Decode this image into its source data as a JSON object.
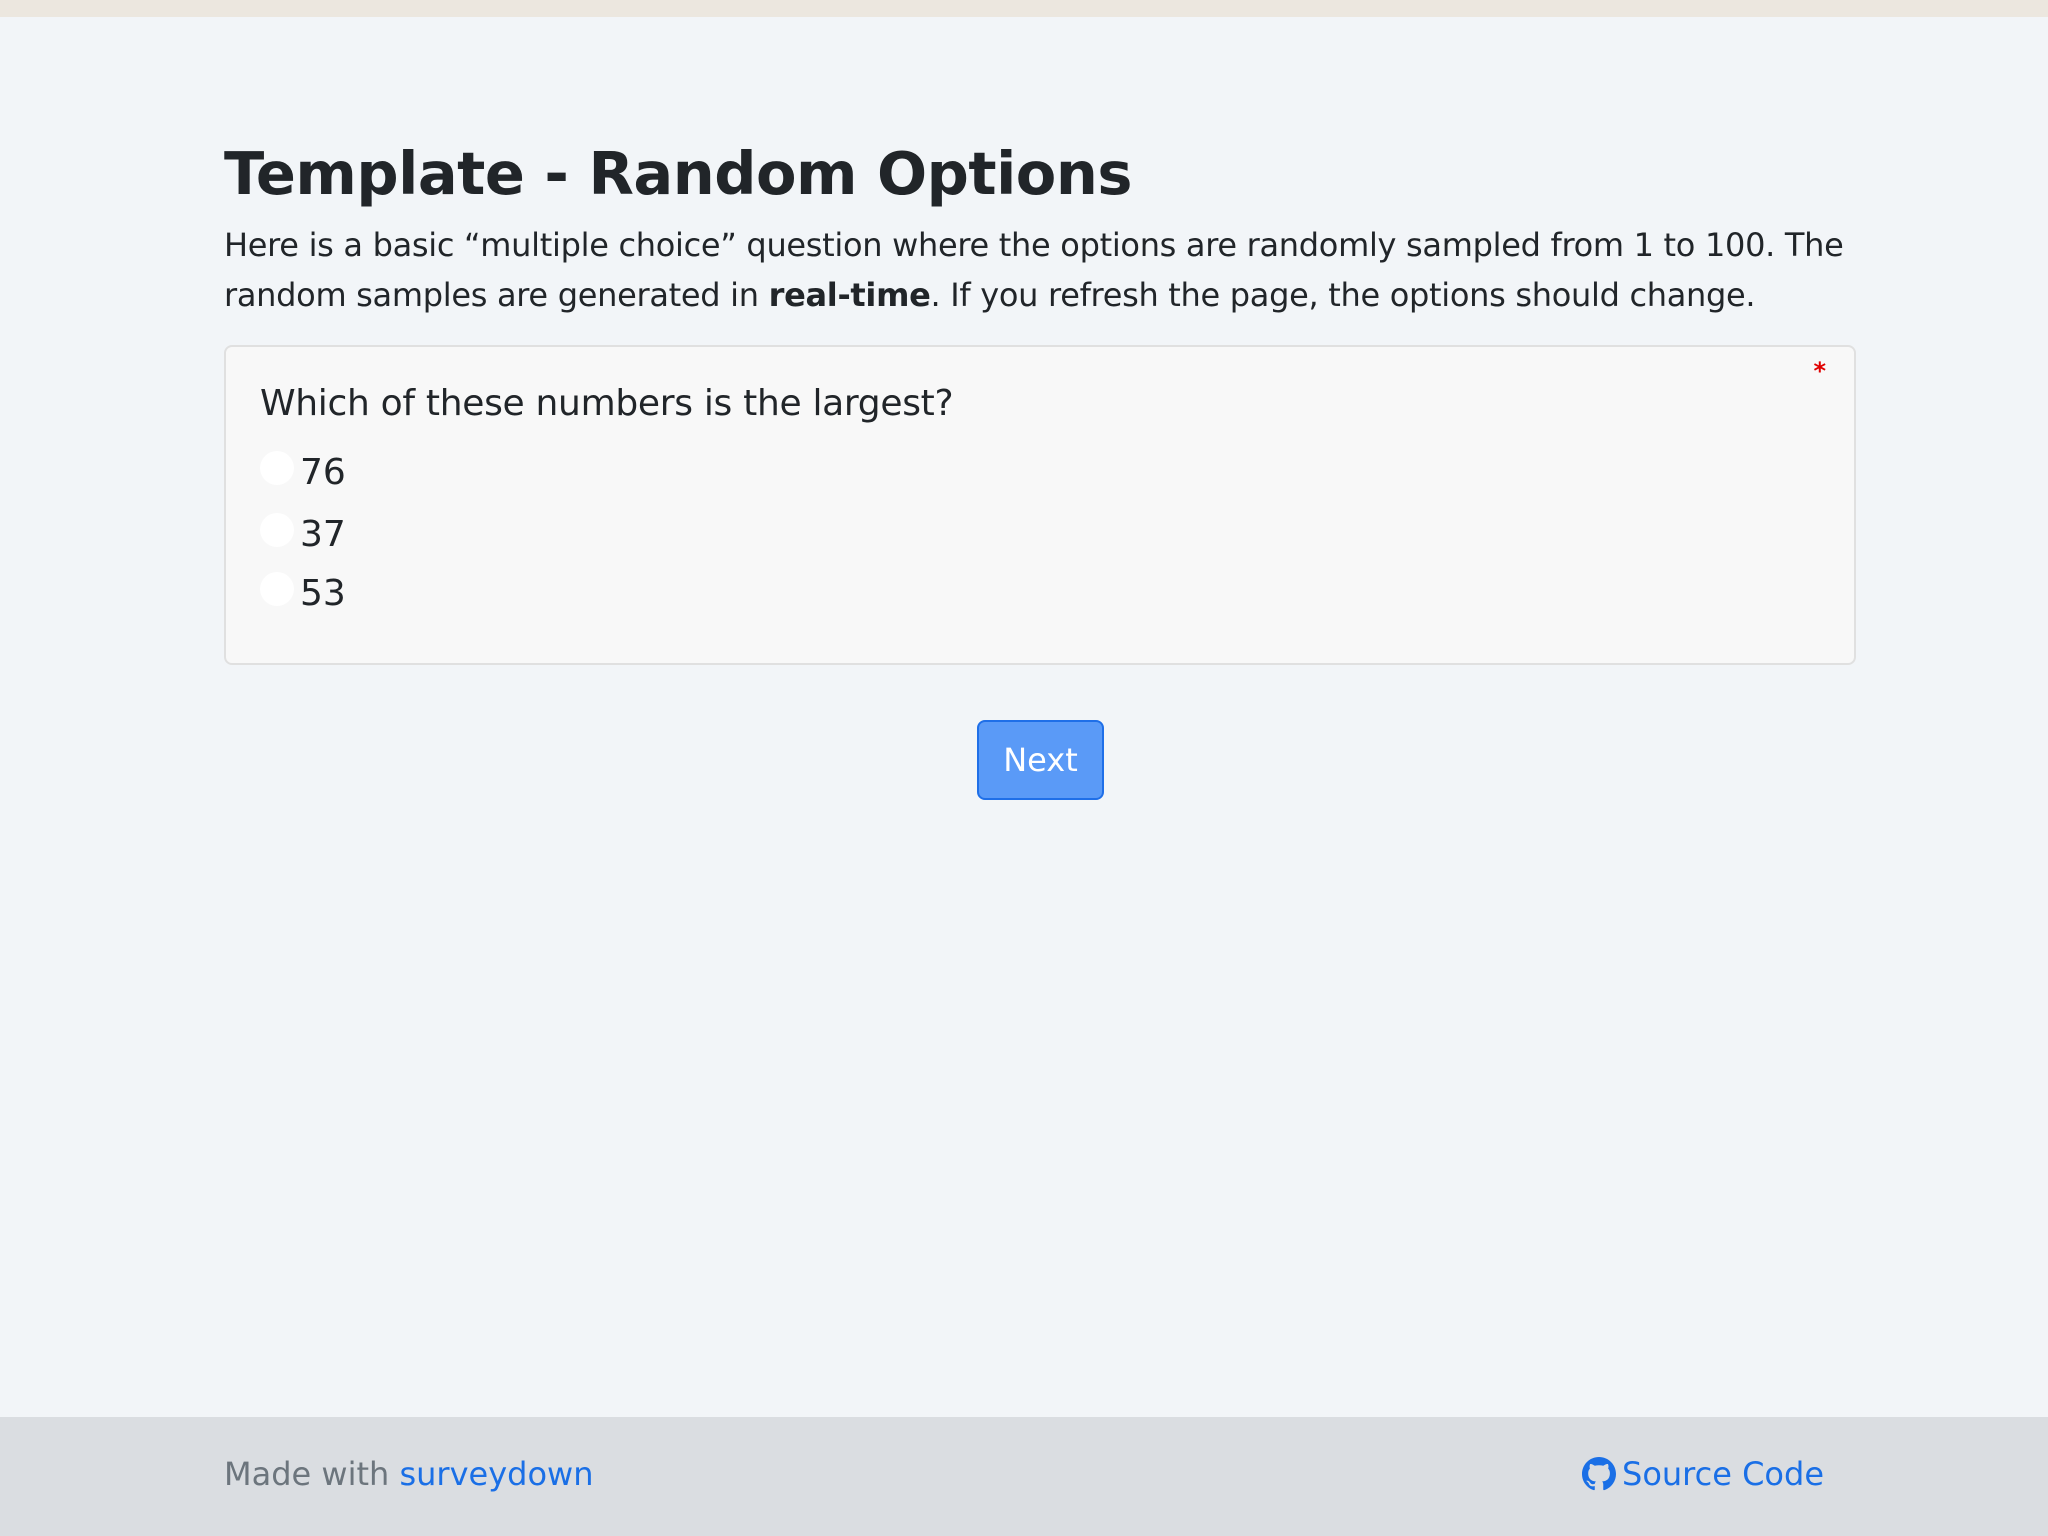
{
  "page": {
    "title": "Template - Random Options",
    "intro_part1": "Here is a basic “multiple choice” question where the options are randomly sampled from 1 to 100. The random samples are generated in ",
    "intro_bold": "real-time",
    "intro_part2": ". If you refresh the page, the options should change."
  },
  "question": {
    "label": "Which of these numbers is the largest?",
    "required_marker": "*",
    "options": [
      {
        "label": "76"
      },
      {
        "label": "37"
      },
      {
        "label": "53"
      }
    ]
  },
  "actions": {
    "next_label": "Next"
  },
  "footer": {
    "made_with": "Made with ",
    "made_with_link": "surveydown",
    "source_code": "Source Code",
    "github_icon": "github-icon"
  },
  "colors": {
    "background": "#f2f5f8",
    "accent": "#5a9af7",
    "link": "#1a6fe6",
    "required": "#e00000"
  }
}
